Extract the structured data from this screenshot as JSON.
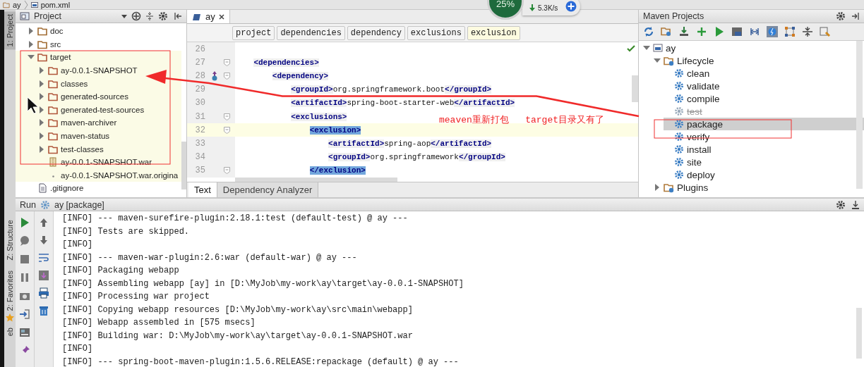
{
  "breadcrumb": [
    "ay",
    "pom.xml"
  ],
  "tool_strip": [
    {
      "label": "1: Project",
      "selected": true
    },
    {
      "label": "Z: Structure",
      "selected": false
    },
    {
      "label": "2: Favorites",
      "selected": false
    },
    {
      "label": "eb",
      "selected": false
    }
  ],
  "project": {
    "title": "Project",
    "tree": [
      {
        "label": "doc",
        "kind": "folder",
        "expanded": false,
        "excluded": false
      },
      {
        "label": "src",
        "kind": "folder",
        "expanded": false,
        "excluded": false
      },
      {
        "label": "target",
        "kind": "folder",
        "expanded": true,
        "excluded": true,
        "children": [
          {
            "label": "ay-0.0.1-SNAPSHOT",
            "kind": "folder",
            "expanded": false,
            "excluded": true
          },
          {
            "label": "classes",
            "kind": "folder",
            "expanded": false,
            "excluded": true
          },
          {
            "label": "generated-sources",
            "kind": "folder",
            "expanded": false,
            "excluded": true
          },
          {
            "label": "generated-test-sources",
            "kind": "folder",
            "expanded": false,
            "excluded": true
          },
          {
            "label": "maven-archiver",
            "kind": "folder",
            "expanded": false,
            "excluded": true
          },
          {
            "label": "maven-status",
            "kind": "folder",
            "expanded": false,
            "excluded": true
          },
          {
            "label": "test-classes",
            "kind": "folder",
            "expanded": false,
            "excluded": true
          },
          {
            "label": "ay-0.0.1-SNAPSHOT.war",
            "kind": "archive",
            "excluded": true
          },
          {
            "label": "ay-0.0.1-SNAPSHOT.war.origina",
            "kind": "file",
            "excluded": true
          }
        ]
      },
      {
        "label": ".gitignore",
        "kind": "text",
        "excluded": false
      }
    ]
  },
  "editor": {
    "tabs": [
      {
        "label": "ay",
        "selected": true
      }
    ],
    "crumbs": [
      {
        "label": "project",
        "selected": false
      },
      {
        "label": "dependencies",
        "selected": false
      },
      {
        "label": "dependency",
        "selected": false
      },
      {
        "label": "exclusions",
        "selected": false
      },
      {
        "label": "exclusion",
        "selected": true
      }
    ],
    "lines": [
      {
        "number": "26",
        "fold": false,
        "marker": false,
        "current": false
      },
      {
        "number": "27",
        "code": "    <dependencies>",
        "fold": true,
        "marker": false,
        "current": false,
        "matched": false
      },
      {
        "number": "28",
        "code": "        <dependency>",
        "fold": true,
        "marker": true,
        "current": false,
        "matched": false
      },
      {
        "number": "29",
        "code": "            <groupId>org.springframework.boot</groupId>",
        "fold": false,
        "marker": false,
        "current": false,
        "matched": false
      },
      {
        "number": "30",
        "code": "            <artifactId>spring-boot-starter-web</artifactId>",
        "fold": false,
        "marker": false,
        "current": false,
        "matched": false
      },
      {
        "number": "31",
        "code": "            <exclusions>",
        "fold": true,
        "marker": false,
        "current": false,
        "matched": false
      },
      {
        "number": "32",
        "code": "                <exclusion>",
        "fold": true,
        "marker": false,
        "current": true,
        "matched": true
      },
      {
        "number": "33",
        "code": "                    <artifactId>spring-aop</artifactId>",
        "fold": false,
        "marker": false,
        "current": false,
        "matched": false
      },
      {
        "number": "34",
        "code": "                    <groupId>org.springframework</groupId>",
        "fold": false,
        "marker": false,
        "current": false,
        "matched": false
      },
      {
        "number": "35",
        "code": "                </exclusion>",
        "fold": true,
        "marker": false,
        "current": false,
        "matched": true
      }
    ],
    "bottom_tabs": [
      {
        "label": "Text",
        "selected": true
      },
      {
        "label": "Dependency Analyzer",
        "selected": false
      }
    ]
  },
  "maven": {
    "title": "Maven Projects",
    "tree": [
      {
        "label": "ay",
        "kind": "project",
        "expanded": true,
        "children": [
          {
            "label": "Lifecycle",
            "kind": "lifecycle",
            "expanded": true,
            "children": [
              {
                "label": "clean",
                "kind": "goal",
                "selected": false,
                "disabled": false
              },
              {
                "label": "validate",
                "kind": "goal",
                "selected": false,
                "disabled": false
              },
              {
                "label": "compile",
                "kind": "goal",
                "selected": false,
                "disabled": false
              },
              {
                "label": "test",
                "kind": "goal",
                "selected": false,
                "disabled": true
              },
              {
                "label": "package",
                "kind": "goal",
                "selected": true,
                "disabled": false
              },
              {
                "label": "verify",
                "kind": "goal",
                "selected": false,
                "disabled": false
              },
              {
                "label": "install",
                "kind": "goal",
                "selected": false,
                "disabled": false
              },
              {
                "label": "site",
                "kind": "goal",
                "selected": false,
                "disabled": false
              },
              {
                "label": "deploy",
                "kind": "goal",
                "selected": false,
                "disabled": false
              }
            ]
          },
          {
            "label": "Plugins",
            "kind": "lifecycle",
            "expanded": false
          }
        ]
      }
    ]
  },
  "run": {
    "title": "Run",
    "config": "ay [package]",
    "lines": [
      "[INFO] --- maven-surefire-plugin:2.18.1:test (default-test) @ ay ---",
      "[INFO] Tests are skipped.",
      "[INFO]",
      "[INFO] --- maven-war-plugin:2.6:war (default-war) @ ay ---",
      "[INFO] Packaging webapp",
      "[INFO] Assembling webapp [ay] in [D:\\MyJob\\my-work\\ay\\target\\ay-0.0.1-SNAPSHOT]",
      "[INFO] Processing war project",
      "[INFO] Copying webapp resources [D:\\MyJob\\my-work\\ay\\src\\main\\webapp]",
      "[INFO] Webapp assembled in [575 msecs]",
      "[INFO] Building war: D:\\MyJob\\my-work\\ay\\target\\ay-0.0.1-SNAPSHOT.war",
      "[INFO]",
      "[INFO] --- spring-boot-maven-plugin:1.5.6.RELEASE:repackage (default) @ ay ---"
    ]
  },
  "network_widget": {
    "percent": "25%",
    "download": "5.3K/s"
  },
  "annotation": {
    "text": "meaven重新打包   target目录又有了"
  }
}
